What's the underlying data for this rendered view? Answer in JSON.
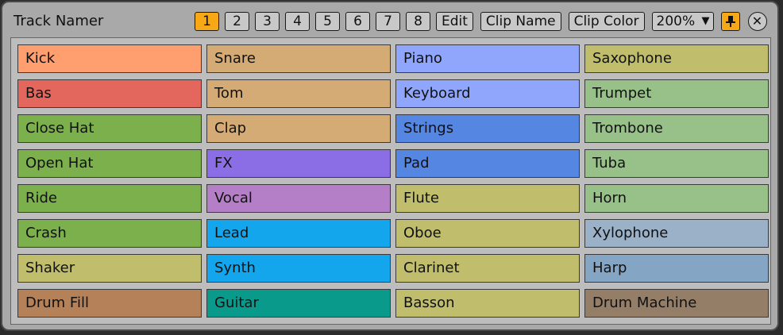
{
  "window": {
    "title": "Track Namer"
  },
  "toolbar": {
    "tracks": [
      {
        "label": "1",
        "active": true
      },
      {
        "label": "2",
        "active": false
      },
      {
        "label": "3",
        "active": false
      },
      {
        "label": "4",
        "active": false
      },
      {
        "label": "5",
        "active": false
      },
      {
        "label": "6",
        "active": false
      },
      {
        "label": "7",
        "active": false
      },
      {
        "label": "8",
        "active": false
      }
    ],
    "edit_label": "Edit",
    "clip_name_label": "Clip Name",
    "clip_color_label": "Clip Color",
    "zoom_value": "200%",
    "zoom_arrow": "▼",
    "pin_icon": "pin-icon",
    "pin_glyph": "📌",
    "close_glyph": "✕",
    "accent_color": "#f7a817"
  },
  "grid": {
    "columns": [
      [
        {
          "label": "Kick",
          "color": "#ff9e6e"
        },
        {
          "label": "Bas",
          "color": "#e4675d"
        },
        {
          "label": "Close Hat",
          "color": "#7bb04c"
        },
        {
          "label": "Open Hat",
          "color": "#7bb04c"
        },
        {
          "label": "Ride",
          "color": "#7bb04c"
        },
        {
          "label": "Crash",
          "color": "#7bb04c"
        },
        {
          "label": "Shaker",
          "color": "#c0bd6c"
        },
        {
          "label": "Drum Fill",
          "color": "#b48158"
        }
      ],
      [
        {
          "label": "Snare",
          "color": "#d4ab74"
        },
        {
          "label": "Tom",
          "color": "#d4ab74"
        },
        {
          "label": "Clap",
          "color": "#d4ab74"
        },
        {
          "label": "FX",
          "color": "#8b6ee5"
        },
        {
          "label": "Vocal",
          "color": "#b47fc7"
        },
        {
          "label": "Lead",
          "color": "#14a6ec"
        },
        {
          "label": "Synth",
          "color": "#14a6ec"
        },
        {
          "label": "Guitar",
          "color": "#0a9a8c"
        }
      ],
      [
        {
          "label": "Piano",
          "color": "#90a6fd"
        },
        {
          "label": "Keyboard",
          "color": "#90a6fd"
        },
        {
          "label": "Strings",
          "color": "#5486e2"
        },
        {
          "label": "Pad",
          "color": "#5486e2"
        },
        {
          "label": "Flute",
          "color": "#c0bd6c"
        },
        {
          "label": "Oboe",
          "color": "#c0bd6c"
        },
        {
          "label": "Clarinet",
          "color": "#c0bd6c"
        },
        {
          "label": "Basson",
          "color": "#c0bd6c"
        }
      ],
      [
        {
          "label": "Saxophone",
          "color": "#c0bd6c"
        },
        {
          "label": "Trumpet",
          "color": "#98c18a"
        },
        {
          "label": "Trombone",
          "color": "#98c18a"
        },
        {
          "label": "Tuba",
          "color": "#98c18a"
        },
        {
          "label": "Horn",
          "color": "#98c18a"
        },
        {
          "label": "Xylophone",
          "color": "#9ab1c8"
        },
        {
          "label": "Harp",
          "color": "#84a5c3"
        },
        {
          "label": "Drum Machine",
          "color": "#957e67"
        }
      ]
    ]
  }
}
